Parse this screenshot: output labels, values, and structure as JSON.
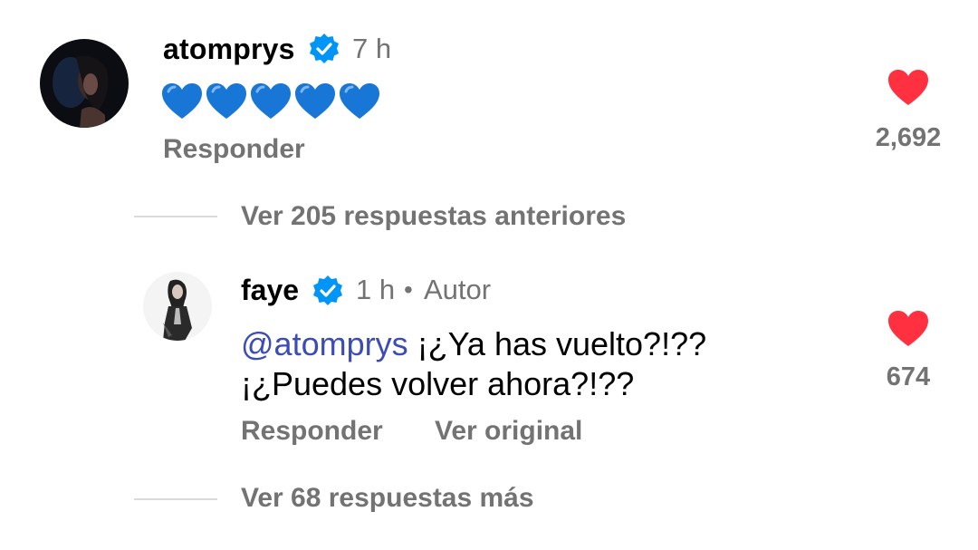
{
  "comments": [
    {
      "username": "atomprys",
      "verified": true,
      "time": "7 h",
      "emoji_text": "💙💙💙💙💙",
      "reply_label": "Responder",
      "like_count": "2,692",
      "liked": true
    },
    {
      "username": "faye",
      "verified": true,
      "time": "1 h",
      "separator": "•",
      "author_label": "Autor",
      "mention": "@atomprys",
      "text": " ¡¿Ya has vuelto?!?? ¡¿Puedes volver ahora?!??",
      "reply_label": "Responder",
      "see_original_label": "Ver original",
      "like_count": "674",
      "liked": true
    }
  ],
  "thread": {
    "previous_replies_label": "Ver 205 respuestas anteriores",
    "more_replies_label": "Ver 68 respuestas más"
  },
  "colors": {
    "heart": "#ff3040",
    "verified": "#0095f6",
    "secondary_text": "#737373",
    "mention": "#3b4bb8",
    "blue_heart": "#1877d6"
  },
  "icons": {
    "verified": "verified-badge-icon",
    "like": "heart-filled-icon"
  }
}
